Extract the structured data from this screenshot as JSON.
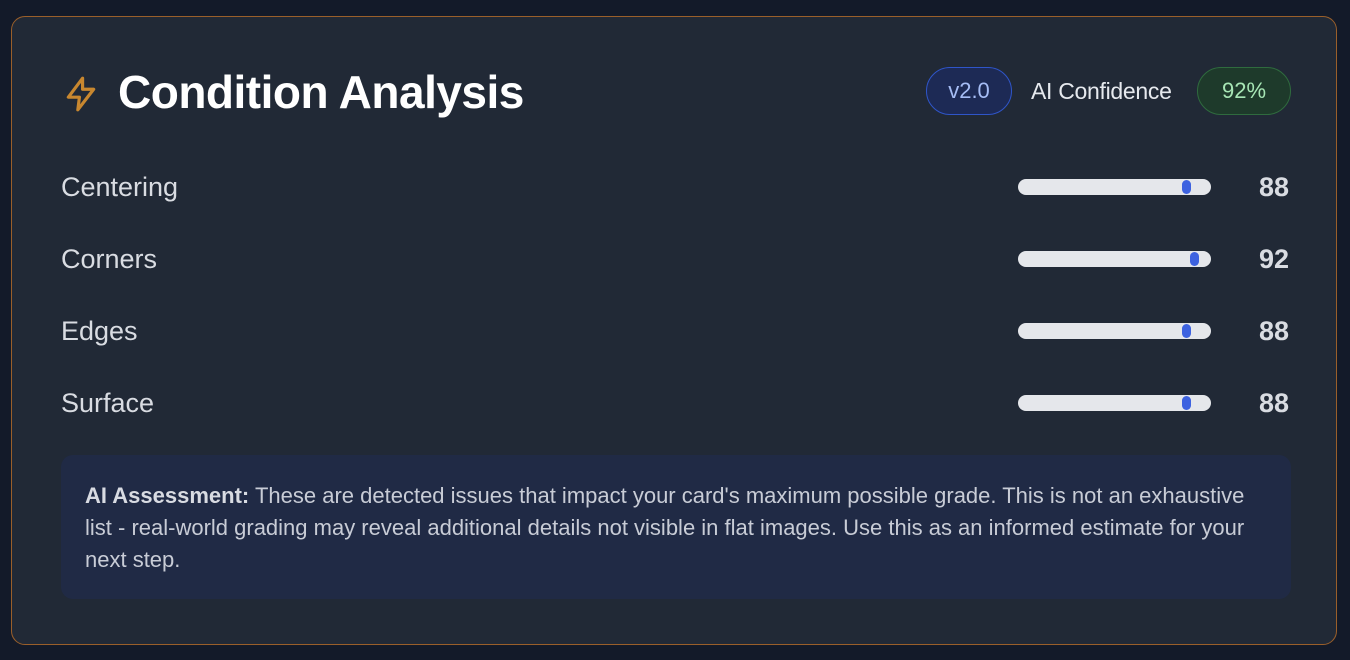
{
  "header": {
    "icon": "lightning-bolt-icon",
    "title": "Condition Analysis",
    "version": "v2.0",
    "confidence_label": "AI Confidence",
    "confidence_value": "92%"
  },
  "metrics": [
    {
      "label": "Centering",
      "value": "88",
      "score": 88
    },
    {
      "label": "Corners",
      "value": "92",
      "score": 92
    },
    {
      "label": "Edges",
      "value": "88",
      "score": 88
    },
    {
      "label": "Surface",
      "value": "88",
      "score": 88
    }
  ],
  "assessment": {
    "label": "AI Assessment:",
    "text": "These are detected issues that impact your card's maximum possible grade. This is not an exhaustive list - real-world grading may reveal additional details not visible in flat images. Use this as an informed estimate for your next step."
  },
  "colors": {
    "accent_border": "#9a5f2a",
    "slider_thumb": "#3d62e0",
    "confidence_green": "#a7e6b5",
    "version_blue": "#a6bdf5"
  }
}
